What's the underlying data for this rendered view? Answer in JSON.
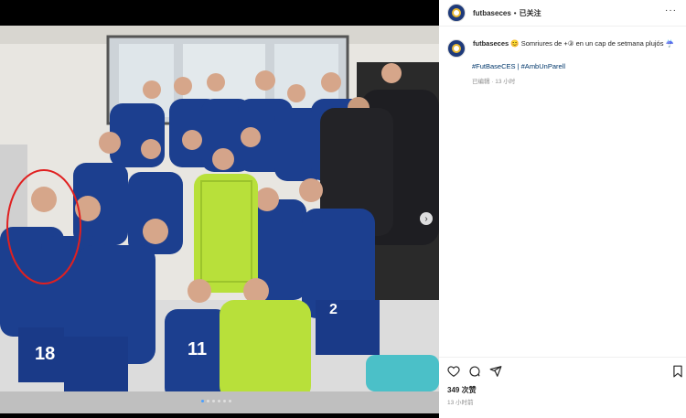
{
  "post": {
    "username": "futbaseces",
    "separator": "•",
    "follow_label": "已关注",
    "more_label": "···"
  },
  "caption": {
    "username": "futbaseces",
    "text": "😊 Somriures de +③ en un cap de setmana plujós ☔",
    "hashtags": "#FutBaseCES | #AmbUnParell",
    "edited": "已编辑 · 13 小时"
  },
  "engagement": {
    "likes": "349 次赞",
    "time": "13 小时前"
  },
  "carousel": {
    "next_label": "›",
    "dots": 6,
    "active_dot": 1
  },
  "photo": {
    "description": "team celebration in locker room",
    "jersey_numbers": [
      "18",
      "11",
      "2"
    ],
    "colors": {
      "kit_blue": "#1c3f8f",
      "keeper_green": "#b8e03a",
      "wall": "#e8e6e1"
    }
  }
}
